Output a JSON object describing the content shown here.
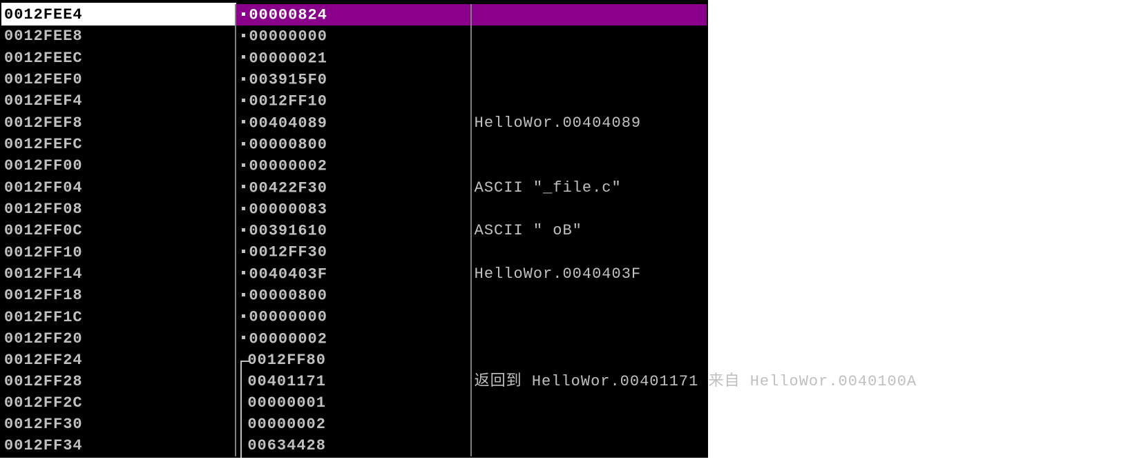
{
  "stack": {
    "selected_index": 0,
    "rows": [
      {
        "addr": "0012FEE4",
        "marker": "dot",
        "value": "00000824",
        "comment": ""
      },
      {
        "addr": "0012FEE8",
        "marker": "dot",
        "value": "00000000",
        "comment": ""
      },
      {
        "addr": "0012FEEC",
        "marker": "dot",
        "value": "00000021",
        "comment": ""
      },
      {
        "addr": "0012FEF0",
        "marker": "dot",
        "value": "003915F0",
        "comment": ""
      },
      {
        "addr": "0012FEF4",
        "marker": "dot",
        "value": "0012FF10",
        "comment": ""
      },
      {
        "addr": "0012FEF8",
        "marker": "dot",
        "value": "00404089",
        "comment": "HelloWor.00404089"
      },
      {
        "addr": "0012FEFC",
        "marker": "dot",
        "value": "00000800",
        "comment": ""
      },
      {
        "addr": "0012FF00",
        "marker": "dot",
        "value": "00000002",
        "comment": ""
      },
      {
        "addr": "0012FF04",
        "marker": "dot",
        "value": "00422F30",
        "comment": "ASCII \"_file.c\""
      },
      {
        "addr": "0012FF08",
        "marker": "dot",
        "value": "00000083",
        "comment": ""
      },
      {
        "addr": "0012FF0C",
        "marker": "dot",
        "value": "00391610",
        "comment": "ASCII \" oB\""
      },
      {
        "addr": "0012FF10",
        "marker": "dot",
        "value": "0012FF30",
        "comment": ""
      },
      {
        "addr": "0012FF14",
        "marker": "dot",
        "value": "0040403F",
        "comment": "HelloWor.0040403F"
      },
      {
        "addr": "0012FF18",
        "marker": "dot",
        "value": "00000800",
        "comment": ""
      },
      {
        "addr": "0012FF1C",
        "marker": "dot",
        "value": "00000000",
        "comment": ""
      },
      {
        "addr": "0012FF20",
        "marker": "dot",
        "value": "00000002",
        "comment": ""
      },
      {
        "addr": "0012FF24",
        "marker": "btop",
        "value": "0012FF80",
        "comment": ""
      },
      {
        "addr": "0012FF28",
        "marker": "bmid",
        "value": "00401171",
        "comment": "返回到 HelloWor.00401171 来自 HelloWor.0040100A"
      },
      {
        "addr": "0012FF2C",
        "marker": "bmid",
        "value": "00000001",
        "comment": ""
      },
      {
        "addr": "0012FF30",
        "marker": "bmid",
        "value": "00000002",
        "comment": ""
      },
      {
        "addr": "0012FF34",
        "marker": "bmid",
        "value": "00634428",
        "comment": ""
      }
    ]
  }
}
